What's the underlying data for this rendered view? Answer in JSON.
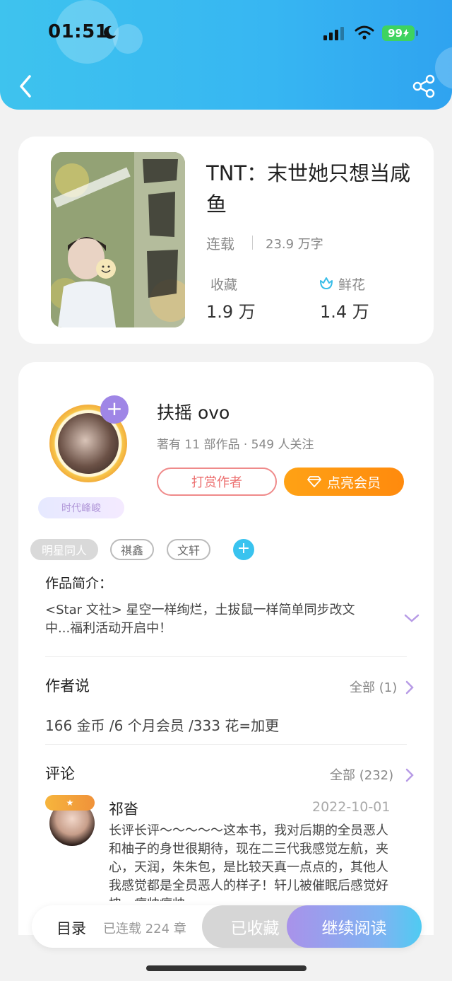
{
  "status_bar": {
    "time": "01:51",
    "battery": "99"
  },
  "book": {
    "title": "TNT：末世她只想当咸鱼",
    "status": "连载",
    "word_count": "23.9 万字",
    "favorites_label": "收藏",
    "favorites_value": "1.9 万",
    "flowers_label": "鲜花",
    "flowers_value": "1.4 万"
  },
  "author": {
    "name": "扶摇 ovo",
    "meta": "著有 11 部作品 · 549 人关注",
    "badge": "时代峰峻",
    "tip_button": "打赏作者",
    "vip_button": "点亮会员"
  },
  "tags": [
    "明星同人",
    "祺鑫",
    "文轩"
  ],
  "intro": {
    "title": "作品简介：",
    "text": "<Star 文社> 星空一样绚烂，土拔鼠一样简单同步改文中...福利活动开启中！"
  },
  "author_says": {
    "title": "作者说",
    "more": "全部 (1)",
    "text": "166 金币 /6 个月会员 /333 花=加更"
  },
  "comments": {
    "title": "评论",
    "more": "全部 (232)",
    "items": [
      {
        "user": "祁沓",
        "date": "2022-10-01",
        "text": "长评长评～～～～～这本书，我对后期的全员恶人和柚子的身世很期待，现在二三代我感觉左航，夹心，天润，朱朱包，是比较天真一点点的，其他人我感觉都是全员恶人的样子！轩儿被催眠后感觉好拽，痞帅痞帅，"
      }
    ]
  },
  "bottom_bar": {
    "toc": "目录",
    "chapters": "已连载 224 章",
    "collected": "已收藏",
    "continue": "继续阅读"
  },
  "colors": {
    "header": "#37b6f2",
    "vip": "#ff9411",
    "tip": "#ec6f6f",
    "accent_purple": "#9f86e6"
  }
}
